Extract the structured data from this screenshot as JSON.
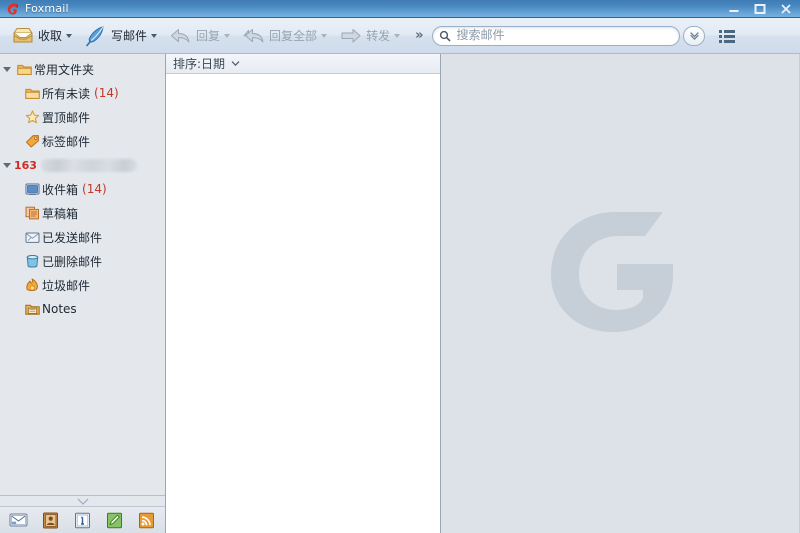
{
  "window": {
    "title": "Foxmail",
    "logo_icon": "foxmail-g-logo",
    "buttons": [
      {
        "name": "minimize",
        "icon": "minimize-icon",
        "label": "—"
      },
      {
        "name": "maximize",
        "icon": "maximize-icon",
        "label": "□"
      },
      {
        "name": "close",
        "icon": "close-icon",
        "label": "✕"
      }
    ]
  },
  "toolbar": {
    "buttons": [
      {
        "label": "收取",
        "icon": "inbox-tray-icon",
        "has_caret": true,
        "disabled": false
      },
      {
        "label": "写邮件",
        "icon": "quill-pen-icon",
        "has_caret": true,
        "disabled": false
      },
      {
        "label": "回复",
        "icon": "reply-arrow-icon",
        "has_caret": true,
        "disabled": true
      },
      {
        "label": "回复全部",
        "icon": "reply-all-arrow-icon",
        "has_caret": true,
        "disabled": true
      },
      {
        "label": "转发",
        "icon": "forward-arrow-icon",
        "has_caret": true,
        "disabled": true
      }
    ],
    "overflow_label": "»",
    "search": {
      "placeholder": "搜索邮件",
      "value": "",
      "icon": "search-icon",
      "dropdown_icon": "chevron-down-icon"
    },
    "list_toggle_icon": "list-view-icon"
  },
  "sidebar": {
    "groups": [
      {
        "label": "常用文件夹",
        "icon": "folder-icon",
        "expanded": true,
        "items": [
          {
            "label": "所有未读",
            "icon": "folder-icon",
            "count": "(14)"
          },
          {
            "label": "置顶邮件",
            "icon": "star-icon",
            "count": ""
          },
          {
            "label": "标签邮件",
            "icon": "tag-icon",
            "count": ""
          }
        ]
      },
      {
        "label": "",
        "account_tag": "163",
        "redacted": true,
        "icon": "account-icon",
        "expanded": true,
        "items": [
          {
            "label": "收件箱",
            "icon": "inbox-icon",
            "count": "(14)"
          },
          {
            "label": "草稿箱",
            "icon": "drafts-icon",
            "count": ""
          },
          {
            "label": "已发送邮件",
            "icon": "sent-icon",
            "count": ""
          },
          {
            "label": "已删除邮件",
            "icon": "trash-icon",
            "count": ""
          },
          {
            "label": "垃圾邮件",
            "icon": "junk-icon",
            "count": ""
          },
          {
            "label": "Notes",
            "icon": "notes-icon",
            "count": ""
          }
        ]
      }
    ],
    "bottom_icons": [
      {
        "name": "mail-icon"
      },
      {
        "name": "contacts-icon"
      },
      {
        "name": "calendar-icon"
      },
      {
        "name": "notepad-icon"
      },
      {
        "name": "rss-icon"
      }
    ],
    "splitter_icon": "chevron-down-icon"
  },
  "maillist": {
    "sort_label": "排序:日期",
    "sort_caret_icon": "chevron-down-icon",
    "items": []
  },
  "preview": {
    "watermark_icon": "foxmail-g-watermark",
    "watermark_letter": "G"
  },
  "colors": {
    "titlebar_blue": "#4a89c0",
    "accent_red": "#cf2a24",
    "sidebar_bg": "#e4e8ed",
    "preview_bg": "#dde2e8",
    "count_red": "#c0392b"
  }
}
